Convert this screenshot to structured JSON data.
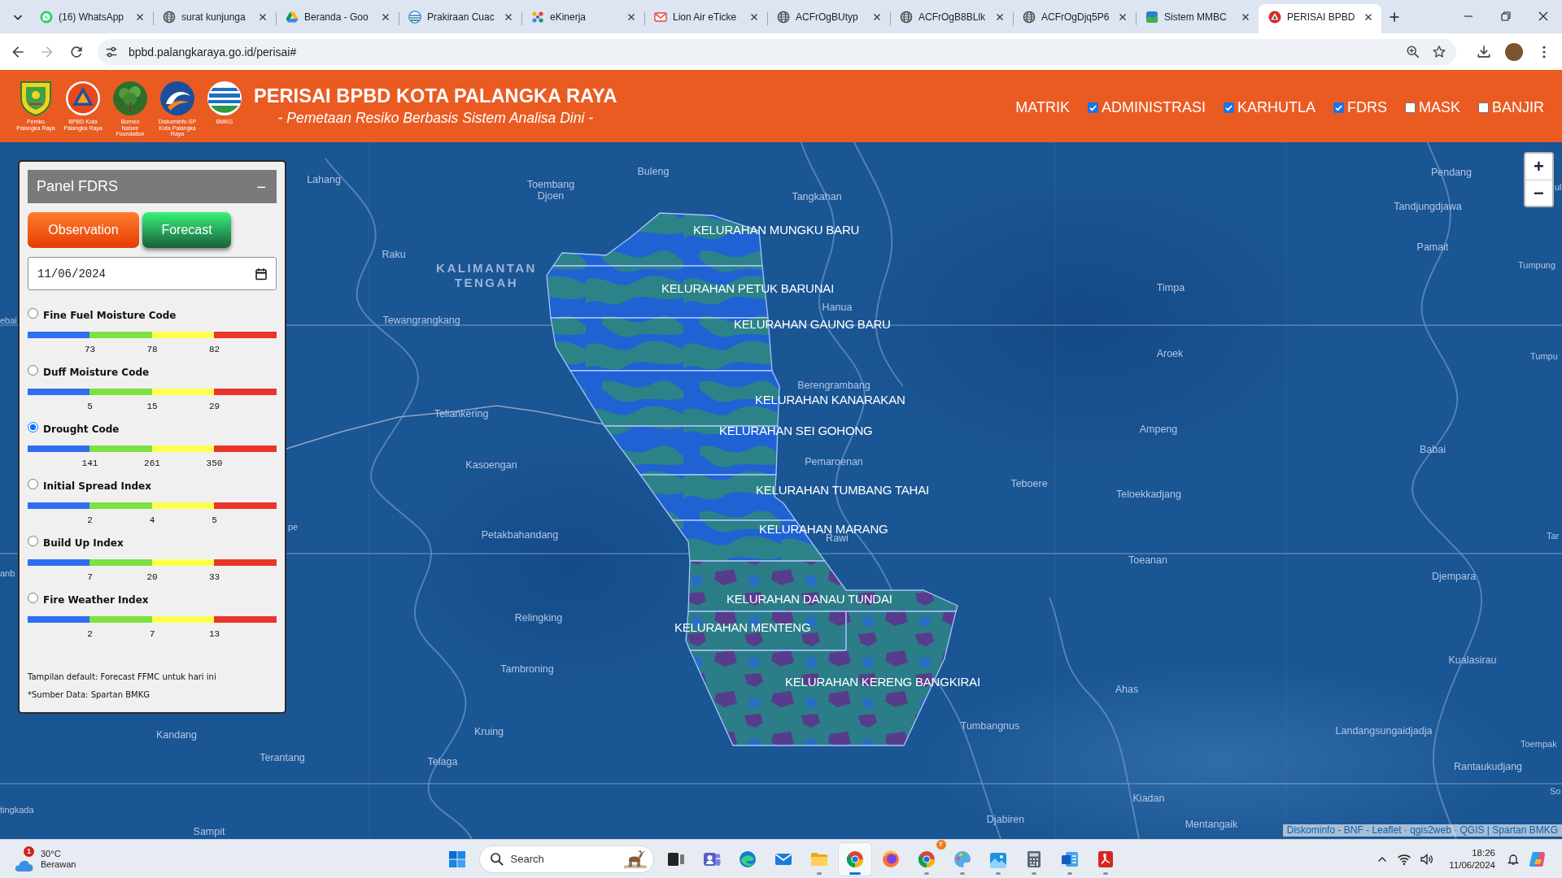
{
  "browser": {
    "tabs": [
      {
        "kind": "whatsapp",
        "title": "(16) WhatsApp",
        "selected": false
      },
      {
        "kind": "globe",
        "title": "surat kunjunga",
        "selected": false
      },
      {
        "kind": "drive",
        "title": "Beranda - Goo",
        "selected": false
      },
      {
        "kind": "weather",
        "title": "Prakiraan Cuac",
        "selected": false
      },
      {
        "kind": "dots",
        "title": "eKinerja",
        "selected": false
      },
      {
        "kind": "mail",
        "title": "Lion Air eTicke",
        "selected": false
      },
      {
        "kind": "globe",
        "title": "ACFrOgBUtyp",
        "selected": false
      },
      {
        "kind": "globe",
        "title": "ACFrOgB8BLlk",
        "selected": false
      },
      {
        "kind": "globe",
        "title": "ACFrOgDjq5P6",
        "selected": false
      },
      {
        "kind": "map",
        "title": "Sistem MMBC",
        "selected": false
      },
      {
        "kind": "emblem",
        "title": "PERISAI BPBD",
        "selected": true
      }
    ],
    "back": {
      "disabled": false
    },
    "forward": {
      "disabled": true
    },
    "url": "bpbd.palangkaraya.go.id/perisai#"
  },
  "header": {
    "logos": [
      {
        "kind": "shield",
        "caption": "Pemko\nPalangka Raya"
      },
      {
        "kind": "triangle",
        "caption": "BPBD Kota\nPalangka Raya"
      },
      {
        "kind": "tree",
        "caption": "Borneo\nNature\nFoundation"
      },
      {
        "kind": "swirl",
        "caption": "Diskominfo-SP\nKota Palangka Raya"
      },
      {
        "kind": "globe",
        "caption": "BMKG"
      }
    ],
    "title": "PERISAI BPBD KOTA PALANGKA RAYA",
    "subtitle": "- Pemetaan Resiko Berbasis Sistem Analisa Dini -",
    "menu_link": "MATRIK",
    "layers": [
      {
        "label": "ADMINISTRASI",
        "checked": true
      },
      {
        "label": "KARHUTLA",
        "checked": true
      },
      {
        "label": "FDRS",
        "checked": true
      },
      {
        "label": "MASK",
        "checked": false
      },
      {
        "label": "BANJIR",
        "checked": false
      }
    ]
  },
  "fdrs_panel": {
    "title": "Panel FDRS",
    "collapse_symbol": "−",
    "modes": [
      {
        "kind": "observation",
        "label": "Observation",
        "selected": false
      },
      {
        "kind": "forecast",
        "label": "Forecast",
        "selected": true
      }
    ],
    "date": "11/06/2024",
    "indices": [
      {
        "label": "Fine Fuel Moisture Code",
        "selected": false,
        "thresholds": [
          "73",
          "78",
          "82"
        ]
      },
      {
        "label": "Duff Moisture Code",
        "selected": false,
        "thresholds": [
          "5",
          "15",
          "29"
        ]
      },
      {
        "label": "Drought Code",
        "selected": true,
        "thresholds": [
          "141",
          "261",
          "350"
        ]
      },
      {
        "label": "Initial Spread Index",
        "selected": false,
        "thresholds": [
          "2",
          "4",
          "5"
        ]
      },
      {
        "label": "Build Up Index",
        "selected": false,
        "thresholds": [
          "7",
          "20",
          "33"
        ]
      },
      {
        "label": "Fire Weather Index",
        "selected": false,
        "thresholds": [
          "2",
          "7",
          "13"
        ]
      }
    ],
    "notes": [
      "Tampilan default: Forecast FFMC untuk hari ini",
      "*Sumber Data: Spartan BMKG"
    ]
  },
  "map": {
    "region_label": "KALIMANTAN\nTENGAH",
    "places": [
      "Lahang",
      "Buleng",
      "Pendang",
      "Toembang\nDjoen",
      "Tangkahan",
      "ul",
      "Tandjungdjawa",
      "Raku",
      "Pamait",
      "Tumpung",
      "Timpa",
      "Hanua",
      "ebai",
      "Tewangrangkang",
      "Aroek",
      "Tumpu",
      "Berengrambang",
      "Teliankering",
      "Ampeng",
      "Babai",
      "Kasoengan",
      "Pemaroenan",
      "Teboere",
      "Teloekkadjang",
      "pe",
      "Petakbahandang",
      "Rawi",
      "Tar",
      "Toeanan",
      "anb",
      "Djempara",
      "Relingking",
      "Tambroning",
      "Kualasirau",
      "Ahas",
      "Kandang",
      "Kruing",
      "Tumbangnus",
      "Landangsungaidjadja",
      "Toempak",
      "Terantang",
      "Telaga",
      "Rantaukudjang",
      "Kiadan",
      "So",
      "tingkada",
      "Djabiren",
      "Sampit",
      "Mentangaik"
    ],
    "districts": [
      "KELURAHAN MUNGKU BARU",
      "KELURAHAN PETUK BARUNAI",
      "KELURAHAN GAUNG BARU",
      "KELURAHAN KANARAKAN",
      "KELURAHAN SEI GOHONG",
      "KELURAHAN TUMBANG TAHAI",
      "KELURAHAN MARANG",
      "KELURAHAN DANAU TUNDAI",
      "KELURAHAN MENTENG",
      "KELURAHAN KERENG BANGKIRAI"
    ],
    "zoom_controls": [
      "+",
      "−"
    ],
    "attribution": "Diskominfo - BNF - Leaflet · qgis2web · QGIS | Spartan BMKG"
  },
  "taskbar": {
    "weather": {
      "temperature": "30°C",
      "condition": "Berawan",
      "badge": "1"
    },
    "search": {
      "placeholder": "Search"
    },
    "apps": [
      {
        "kind": "task-view",
        "running": false,
        "selected": false
      },
      {
        "kind": "teams",
        "running": false,
        "selected": false
      },
      {
        "kind": "edge",
        "running": false,
        "selected": false
      },
      {
        "kind": "mail",
        "running": false,
        "selected": false
      },
      {
        "kind": "explorer",
        "running": true,
        "selected": false
      },
      {
        "kind": "chrome",
        "running": true,
        "selected": true
      },
      {
        "kind": "firefox",
        "running": false,
        "selected": false
      },
      {
        "kind": "chrome",
        "running": true,
        "selected": false,
        "badge": "T"
      },
      {
        "kind": "paint",
        "running": true,
        "selected": false
      },
      {
        "kind": "photos",
        "running": true,
        "selected": false
      },
      {
        "kind": "calculator",
        "running": true,
        "selected": false
      },
      {
        "kind": "word",
        "running": true,
        "selected": false
      },
      {
        "kind": "acrobat",
        "running": true,
        "selected": false
      }
    ],
    "clock": {
      "time": "18:26",
      "date": "11/06/2024"
    }
  }
}
